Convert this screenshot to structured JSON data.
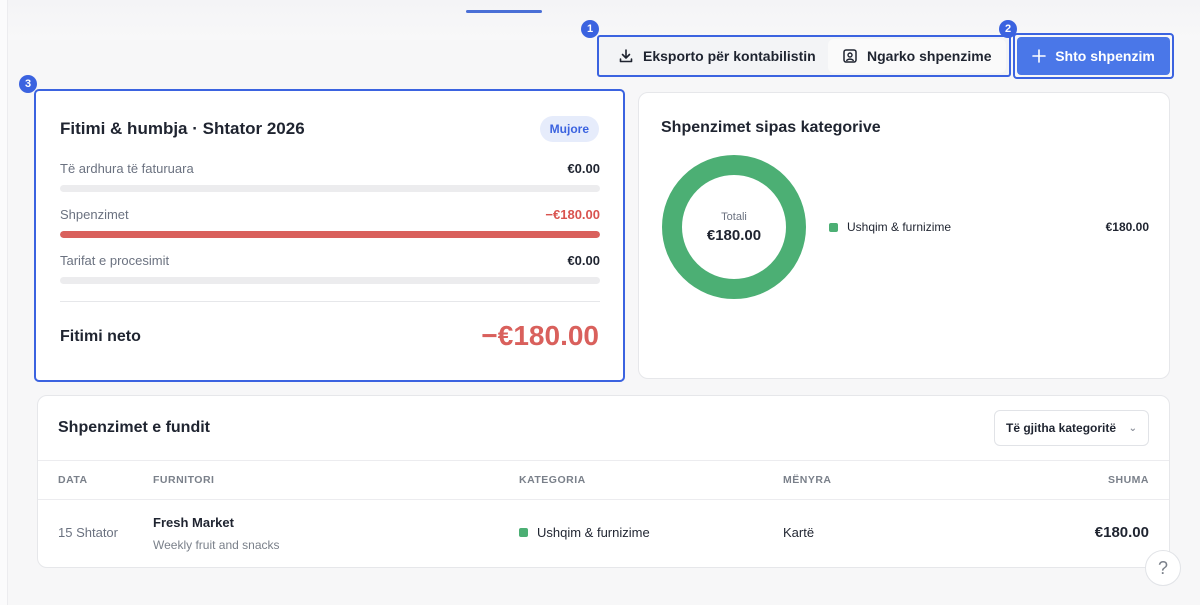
{
  "markers": {
    "one": "1",
    "two": "2",
    "three": "3"
  },
  "actions": {
    "export_label": "Eksporto për kontabilistin",
    "upload_label": "Ngarko shpenzime",
    "add_label": "Shto shpenzim"
  },
  "pl": {
    "title": "Fitimi & humbja · Shtator 2026",
    "period_pill": "Mujore",
    "rows": [
      {
        "label": "Të ardhura të faturuara",
        "amount": "€0.00",
        "fill": 0
      },
      {
        "label": "Shpenzimet",
        "amount": "−€180.00",
        "fill": 1.0
      },
      {
        "label": "Tarifat e procesimit",
        "amount": "€0.00",
        "fill": 0
      }
    ],
    "net_label": "Fitimi neto",
    "net_value": "−€180.00"
  },
  "categories": {
    "title": "Shpenzimet sipas kategorive",
    "total_label": "Totali",
    "total_value": "€180.00",
    "items": [
      {
        "name": "Ushqim & furnizime",
        "amount": "€180.00",
        "share": 1.0,
        "color": "#4caf74"
      }
    ]
  },
  "recent": {
    "title": "Shpenzimet e fundit",
    "filter_value": "Të gjitha kategoritë",
    "columns": [
      "DATA",
      "FURNITORI",
      "KATEGORIA",
      "MËNYRA",
      "SHUMA"
    ],
    "rows": [
      {
        "date": "15 Shtator",
        "vendor": "Fresh Market",
        "note": "Weekly fruit and snacks",
        "category": "Ushqim & furnizime",
        "method": "Kartë",
        "amount": "€180.00"
      }
    ]
  },
  "help": {
    "label": "?"
  },
  "colors": {
    "accent": "#3b63e0",
    "primary": "#4a77e8",
    "negative": "#d9605c",
    "category": "#4caf74"
  }
}
